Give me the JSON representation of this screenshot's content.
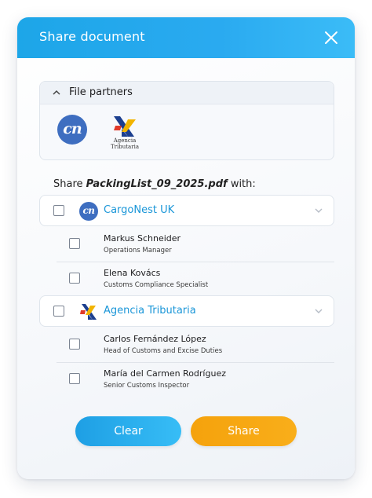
{
  "header": {
    "title": "Share document"
  },
  "partners": {
    "title": "File partners",
    "logos": [
      {
        "name": "CargoNest",
        "icon": "cargonest-logo-icon",
        "mark": "cn"
      },
      {
        "name": "Agencia Tributaria",
        "icon": "agencia-tributaria-logo-icon",
        "caption": "Agencia Tributaria"
      }
    ]
  },
  "share": {
    "prefix": "Share",
    "filename": "PackingList_09_2025.pdf",
    "suffix": "with:"
  },
  "companies": [
    {
      "name": "CargoNest UK",
      "logo_mark": "cn",
      "people": [
        {
          "name": "Markus Schneider",
          "role": "Operations Manager"
        },
        {
          "name": "Elena Kovács",
          "role": "Customs Compliance Specialist"
        }
      ]
    },
    {
      "name": "Agencia Tributaria",
      "people": [
        {
          "name": "Carlos Fernández López",
          "role": "Head of Customs and Excise Duties"
        },
        {
          "name": "María del Carmen Rodríguez",
          "role": "Senior Customs Inspector"
        }
      ]
    }
  ],
  "actions": {
    "clear_label": "Clear",
    "share_label": "Share"
  },
  "colors": {
    "header": "#1da6e8",
    "accent": "#1a96d8",
    "share_button": "#f5a20c",
    "logo_blue": "#3e6ec0"
  }
}
